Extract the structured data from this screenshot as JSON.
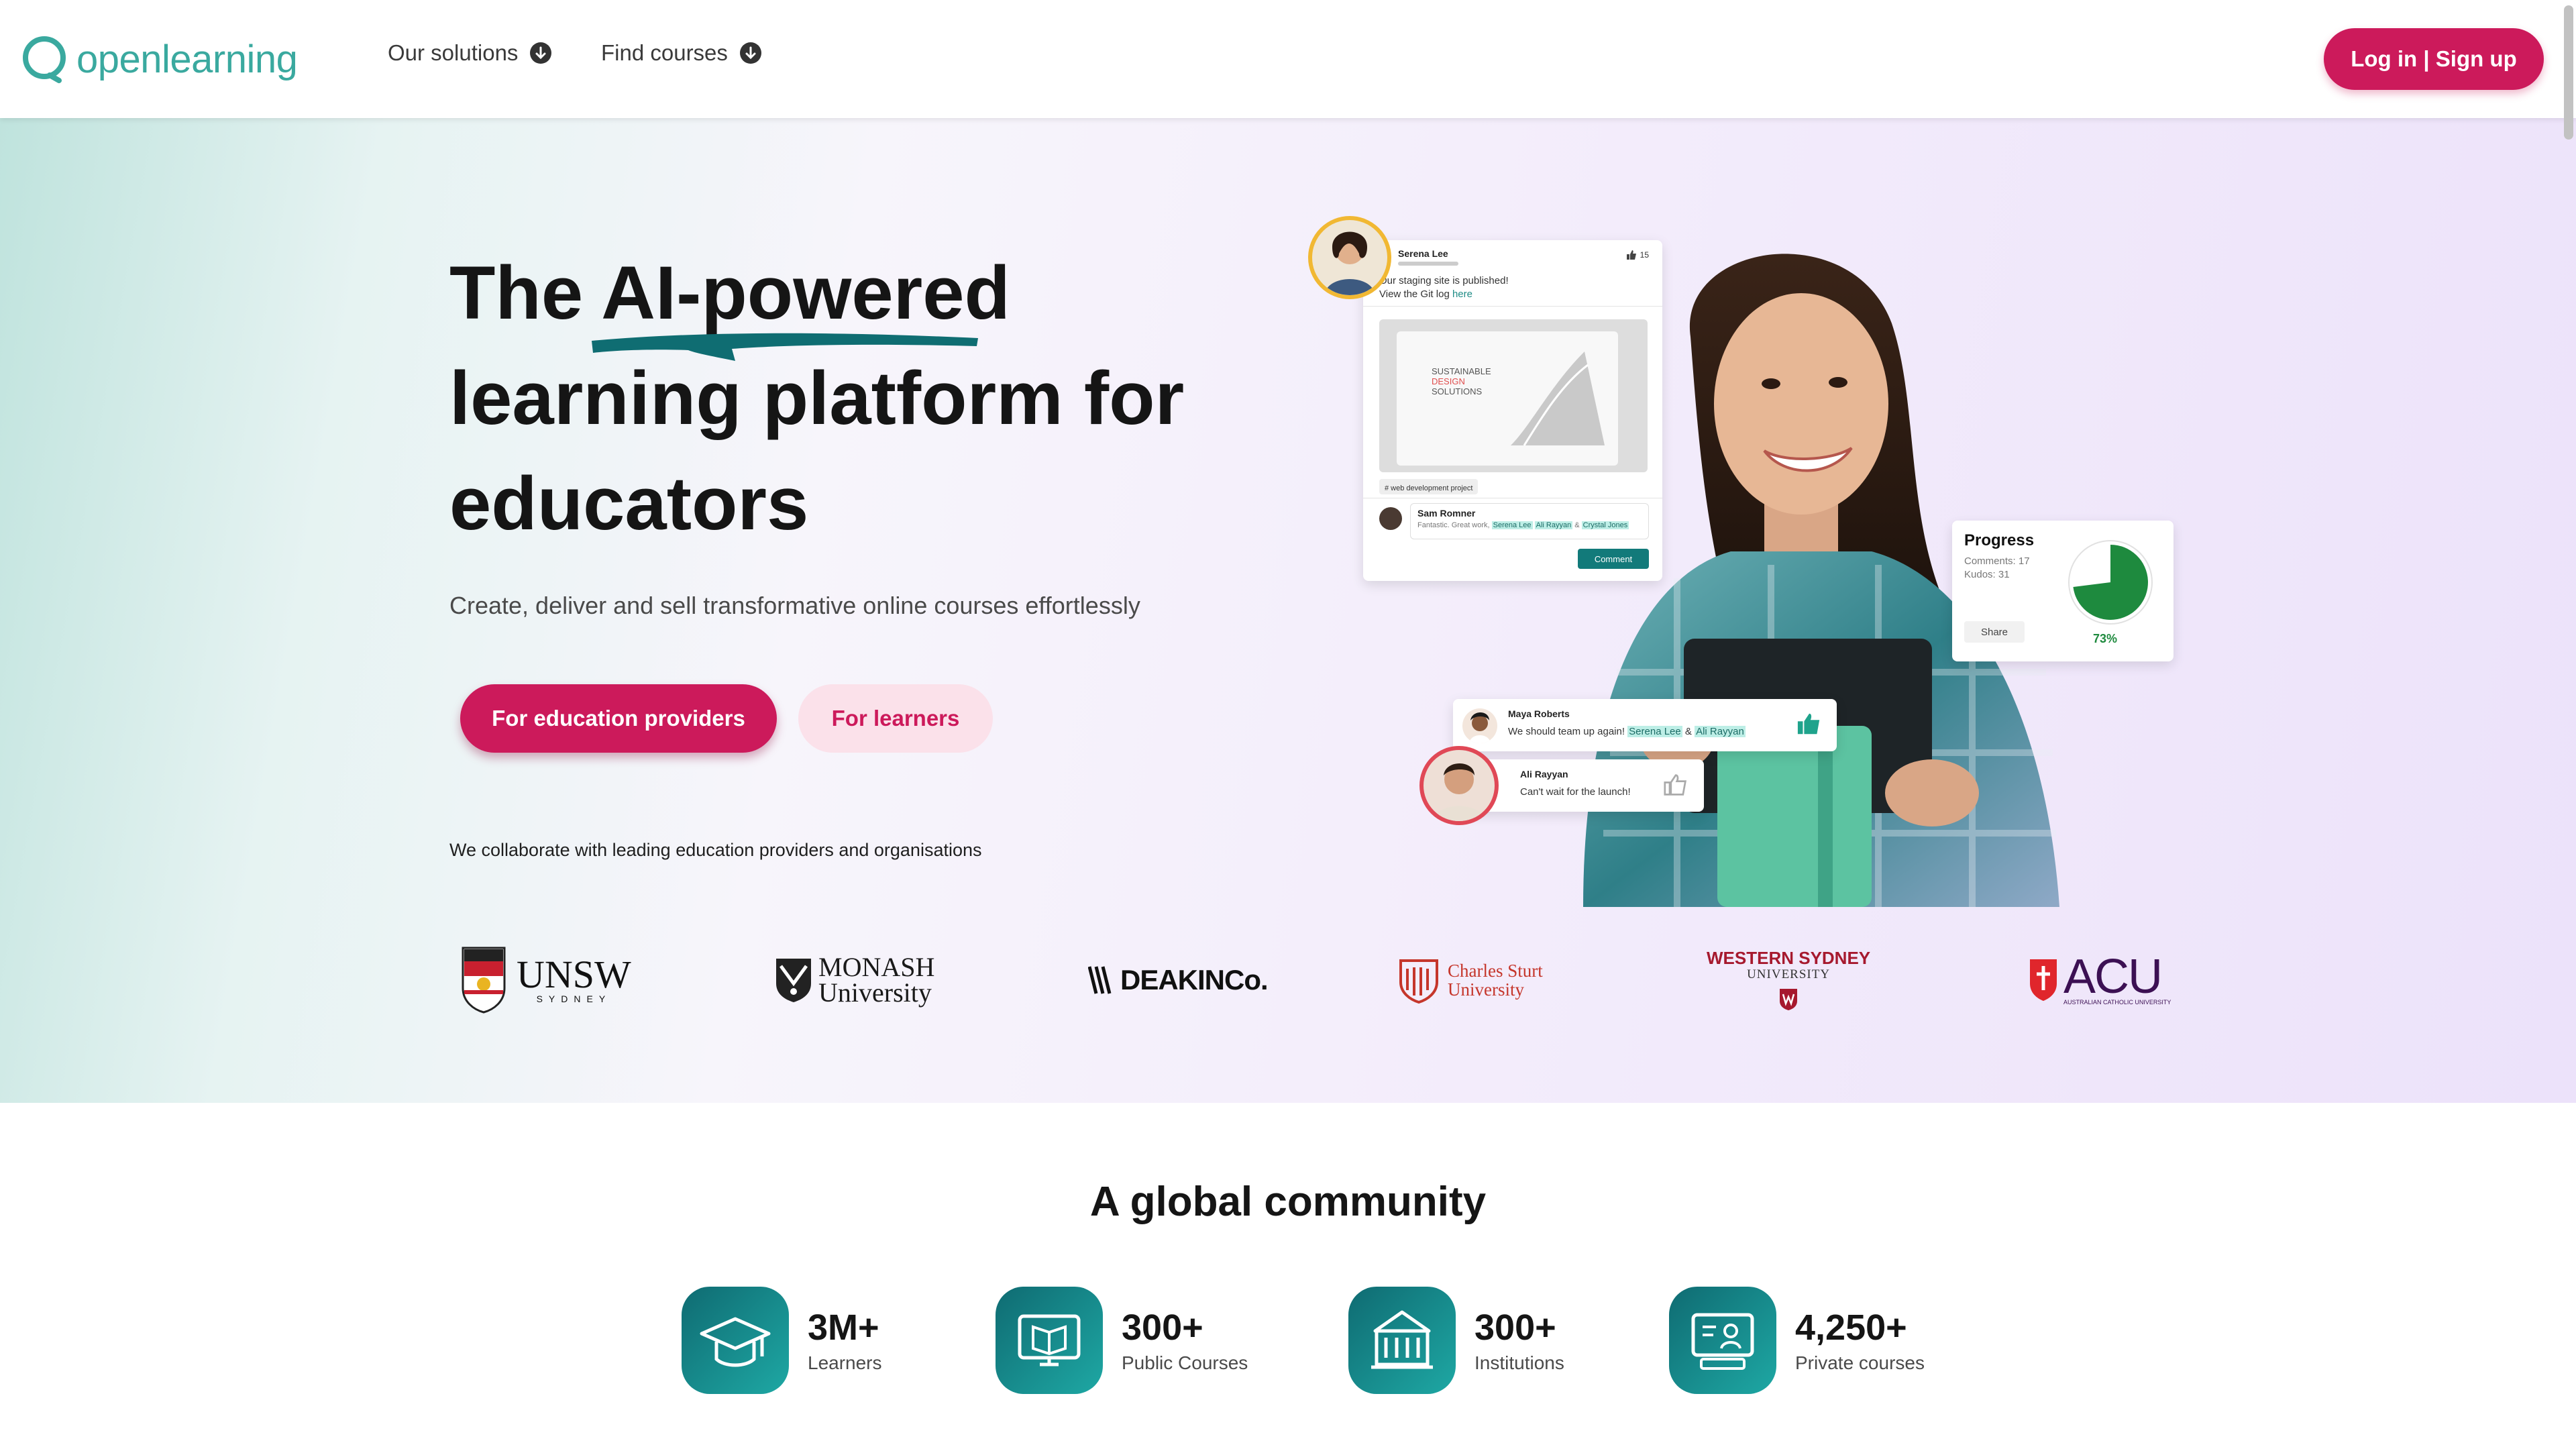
{
  "brand": {
    "name": "openlearning",
    "color": "#3aa99f",
    "accent": "#cc1a5b"
  },
  "nav": {
    "items": [
      {
        "label": "Our solutions"
      },
      {
        "label": "Find courses"
      }
    ],
    "login_label": "Log in | Sign up"
  },
  "hero": {
    "title_line1_prefix": "The ",
    "title_highlight": "AI-powered",
    "title_line2": "learning platform for",
    "title_line3": "educators",
    "subtitle": "Create, deliver and sell transformative online courses effortlessly",
    "primary_cta": "For education providers",
    "secondary_cta": "For learners",
    "collab_text": "We collaborate with leading education providers and organisations"
  },
  "partners": [
    {
      "name": "UNSW",
      "sub": "SYDNEY"
    },
    {
      "name": "MONASH",
      "sub": "University"
    },
    {
      "name": "DEAKINCo."
    },
    {
      "name": "Charles Sturt",
      "sub": "University"
    },
    {
      "name": "WESTERN SYDNEY",
      "sub": "UNIVERSITY"
    },
    {
      "name": "ACU",
      "sub": "AUSTRALIAN CATHOLIC UNIVERSITY"
    }
  ],
  "visual": {
    "post": {
      "author": "Serena Lee",
      "likes": "15",
      "text1": "Our staging site is published!",
      "text2_prefix": "View the Git log ",
      "text2_link": "here",
      "preview_line1": "SUSTAINABLE",
      "preview_line2": "DESIGN",
      "preview_line3": "SOLUTIONS",
      "tag": "# web development project",
      "commenter": "Sam Romner",
      "comment_prefix": "Fantastic. Great work, ",
      "comment_m1": "Serena Lee",
      "comment_m2": "Ali Rayyan",
      "comment_m3": "Crystal Jones",
      "comment_btn": "Comment"
    },
    "progress": {
      "title": "Progress",
      "comments": "Comments: 17",
      "kudos": "Kudos: 31",
      "share": "Share",
      "percent_label": "73%",
      "percent": 0.73,
      "color": "#1e8a3e"
    },
    "chat1": {
      "name": "Maya Roberts",
      "text": "We should team up again! ",
      "m1": "Serena Lee",
      "amp": " & ",
      "m2": "Ali Rayyan"
    },
    "chat2": {
      "name": "Ali Rayyan",
      "text": "Can't wait for the launch!"
    }
  },
  "community": {
    "title": "A global community",
    "stats": [
      {
        "value": "3M+",
        "label": "Learners",
        "icon": "graduation-cap-icon"
      },
      {
        "value": "300+",
        "label": "Public Courses",
        "icon": "monitor-book-icon"
      },
      {
        "value": "300+",
        "label": "Institutions",
        "icon": "building-icon"
      },
      {
        "value": "4,250+",
        "label": "Private courses",
        "icon": "private-course-icon"
      }
    ]
  }
}
